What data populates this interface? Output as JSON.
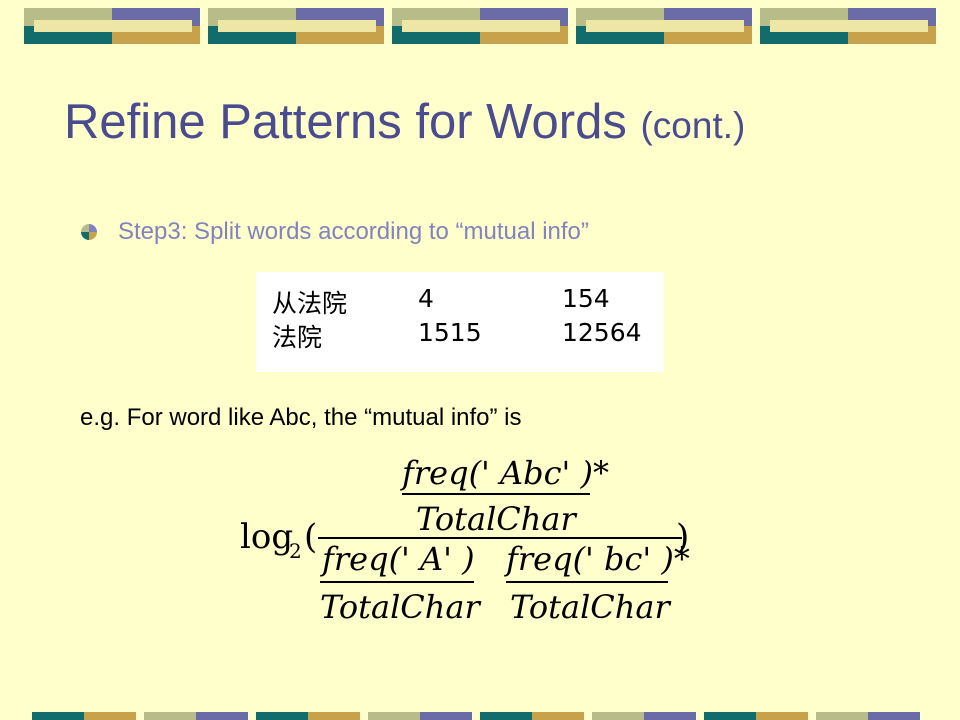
{
  "colors": {
    "background": "#ffffcc",
    "title": "#4b4b8f",
    "bullet_text": "#8282c0",
    "deco_periwinkle": "#6b6ba8",
    "deco_teal": "#126c6c",
    "deco_gold": "#c8a24a",
    "deco_olive": "#b8bc88",
    "deco_cream": "#ede6a5"
  },
  "slide": {
    "title": "Refine Patterns for Words",
    "title_suffix": "(cont.)",
    "bullet": {
      "icon": "pie-bullet-icon",
      "text": "Step3: Split words according to “mutual info”"
    },
    "table": {
      "rows": [
        [
          "从法院",
          "4",
          "154"
        ],
        [
          "法院",
          "1515",
          "12564"
        ]
      ]
    },
    "example_text": "e.g. For word like Abc, the “mutual info” is",
    "formula": {
      "log": "log",
      "base": "2",
      "open_paren": "(",
      "close_paren": ")",
      "numerator_top": "freq(' Abc' )*",
      "numerator_bottom": "TotalChar",
      "left_top": "freq(' A' )",
      "left_bottom": "TotalChar",
      "right_top": "freq(' bc' )*",
      "right_bottom": "TotalChar"
    }
  }
}
